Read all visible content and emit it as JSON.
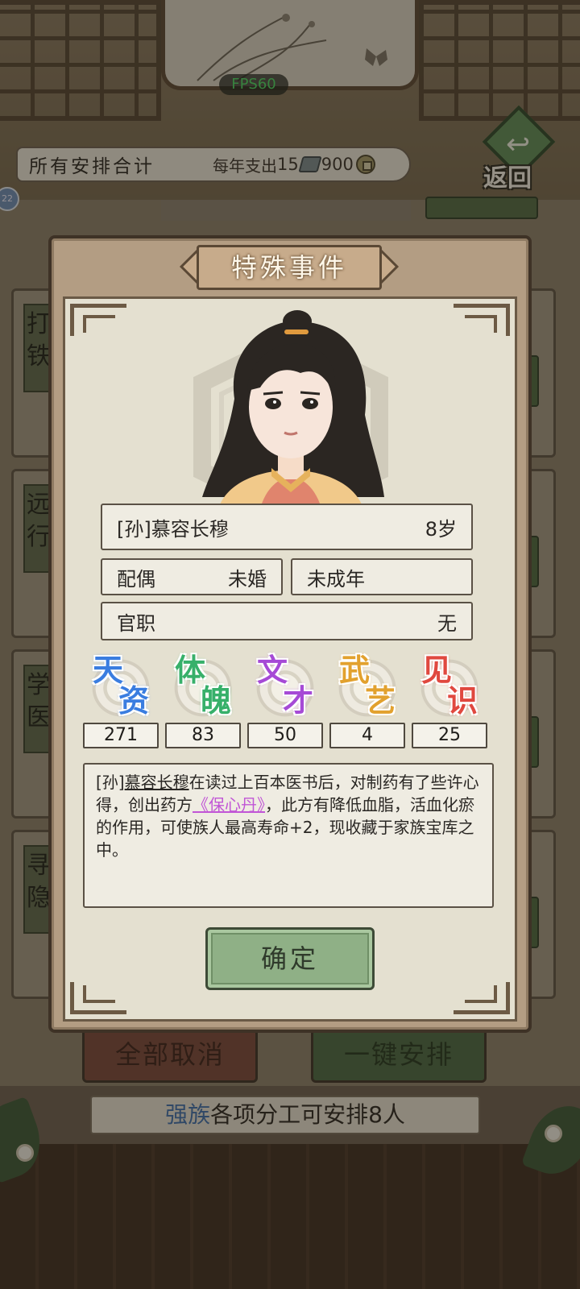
{
  "status": {
    "fps": "FPS60"
  },
  "summary": {
    "title": "所有安排合计",
    "expense_label": "每年支出",
    "silver": "15",
    "coins": "900"
  },
  "nav": {
    "back_label": "返回"
  },
  "badge": {
    "value": "22"
  },
  "background": {
    "row_labels": [
      {
        "c1": "打",
        "c2": "铁"
      },
      {
        "c1": "远",
        "c2": "行"
      },
      {
        "c1": "学",
        "c2": "医"
      },
      {
        "c1": "寻",
        "c2": "隐"
      }
    ],
    "cancel_all_label": "全部取消",
    "auto_arrange_label": "一键安排",
    "info_highlight": "强族",
    "info_text": "各项分工可安排8人"
  },
  "dialog": {
    "title": "特殊事件",
    "person": {
      "name": "[孙]慕容长穆",
      "age": "8岁",
      "spouse_label": "配偶",
      "spouse_value": "未婚",
      "status": "未成年",
      "office_label": "官职",
      "office_value": "无"
    },
    "stats": [
      {
        "c1": "天",
        "c2": "资",
        "value": "271",
        "color": "#3a7de0"
      },
      {
        "c1": "体",
        "c2": "魄",
        "value": "83",
        "color": "#37b06a"
      },
      {
        "c1": "文",
        "c2": "才",
        "value": "50",
        "color": "#a64ad6"
      },
      {
        "c1": "武",
        "c2": "艺",
        "value": "4",
        "color": "#e2a12e"
      },
      {
        "c1": "见",
        "c2": "识",
        "value": "25",
        "color": "#e0483f"
      }
    ],
    "description": {
      "prefix": "[孙]",
      "name": "慕容长穆",
      "part1": "在读过上百本医书后，对制药有了些许心得，创出药方",
      "recipe": "《保心丹》",
      "part2": "，此方有降低血脂，活血化瘀的作用，可使族人最高寿命+2，现收藏于家族宝库之中。"
    },
    "confirm_label": "确定"
  }
}
